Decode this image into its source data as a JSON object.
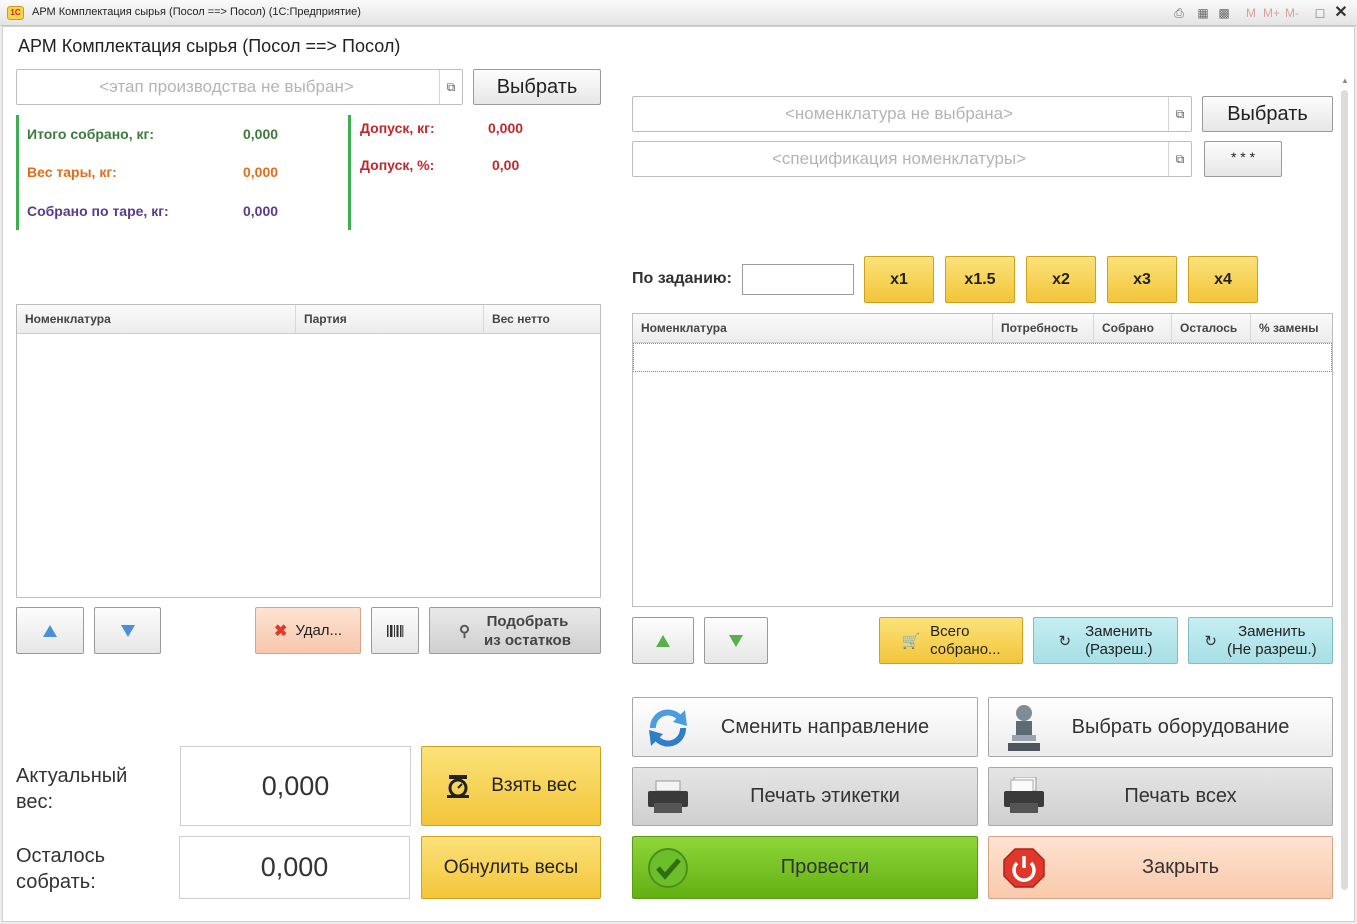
{
  "window": {
    "title": "АРМ Комплектация сырья (Посол ==> Посол)  (1С:Предприятие)",
    "logo_text": "1С",
    "m_buttons": [
      "M",
      "M+",
      "M-"
    ]
  },
  "form": {
    "title": "АРМ Комплектация сырья (Посол ==> Посол)"
  },
  "stage": {
    "placeholder": "<этап производства не выбран>",
    "select_label": "Выбрать"
  },
  "summary": {
    "total_label": "Итого собрано, кг:",
    "total_value": "0,000",
    "tare_label": "Вес тары, кг:",
    "tare_value": "0,000",
    "by_tare_label": "Собрано по таре, кг:",
    "by_tare_value": "0,000",
    "tolerance_kg_label": "Допуск, кг:",
    "tolerance_kg_value": "0,000",
    "tolerance_pct_label": "Допуск, %:",
    "tolerance_pct_value": "0,00",
    "colors": {
      "total": "#3c7a3c",
      "tare": "#e06d1c",
      "by_tare": "#5b3a8c",
      "tolerance": "#c0282c"
    }
  },
  "left_grid": {
    "columns": [
      "Номенклатура",
      "Партия",
      "Вес нетто"
    ],
    "rows": []
  },
  "left_actions": {
    "up_icon": "arrow-up-icon",
    "down_icon": "arrow-down-icon",
    "delete_label": "Удал...",
    "barcode_icon": "barcode-icon",
    "pick_label_1": "Подобрать",
    "pick_label_2": "из остатков"
  },
  "weights": {
    "actual_label_1": "Актуальный",
    "actual_label_2": "вес:",
    "actual_value": "0,000",
    "take_weight_label": "Взять вес",
    "remaining_label_1": "Осталось",
    "remaining_label_2": "собрать:",
    "remaining_value": "0,000",
    "reset_label": "Обнулить весы"
  },
  "nomenclature": {
    "placeholder": "<номенклатура не выбрана>",
    "select_label": "Выбрать",
    "spec_placeholder": "<спецификация номенклатуры>",
    "spec_button_label": "* * *"
  },
  "task": {
    "label": "По заданию:",
    "value": "",
    "multipliers": [
      "x1",
      "x1.5",
      "x2",
      "x3",
      "x4"
    ]
  },
  "right_grid": {
    "columns": [
      "Номенклатура",
      "Потребность",
      "Собрано",
      "Осталось",
      "% замены"
    ],
    "rows": []
  },
  "right_actions": {
    "up_icon": "arrow-up-icon",
    "down_icon": "arrow-down-icon",
    "all_collected_1": "Всего",
    "all_collected_2": "собрано...",
    "replace_allowed_1": "Заменить",
    "replace_allowed_2": "(Разреш.)",
    "replace_notallowed_1": "Заменить",
    "replace_notallowed_2": "(Не разреш.)"
  },
  "bottom_buttons": {
    "change_direction": "Сменить направление",
    "choose_equipment": "Выбрать оборудование",
    "print_label": "Печать этикетки",
    "print_all": "Печать всех",
    "post": "Провести",
    "close": "Закрыть"
  }
}
